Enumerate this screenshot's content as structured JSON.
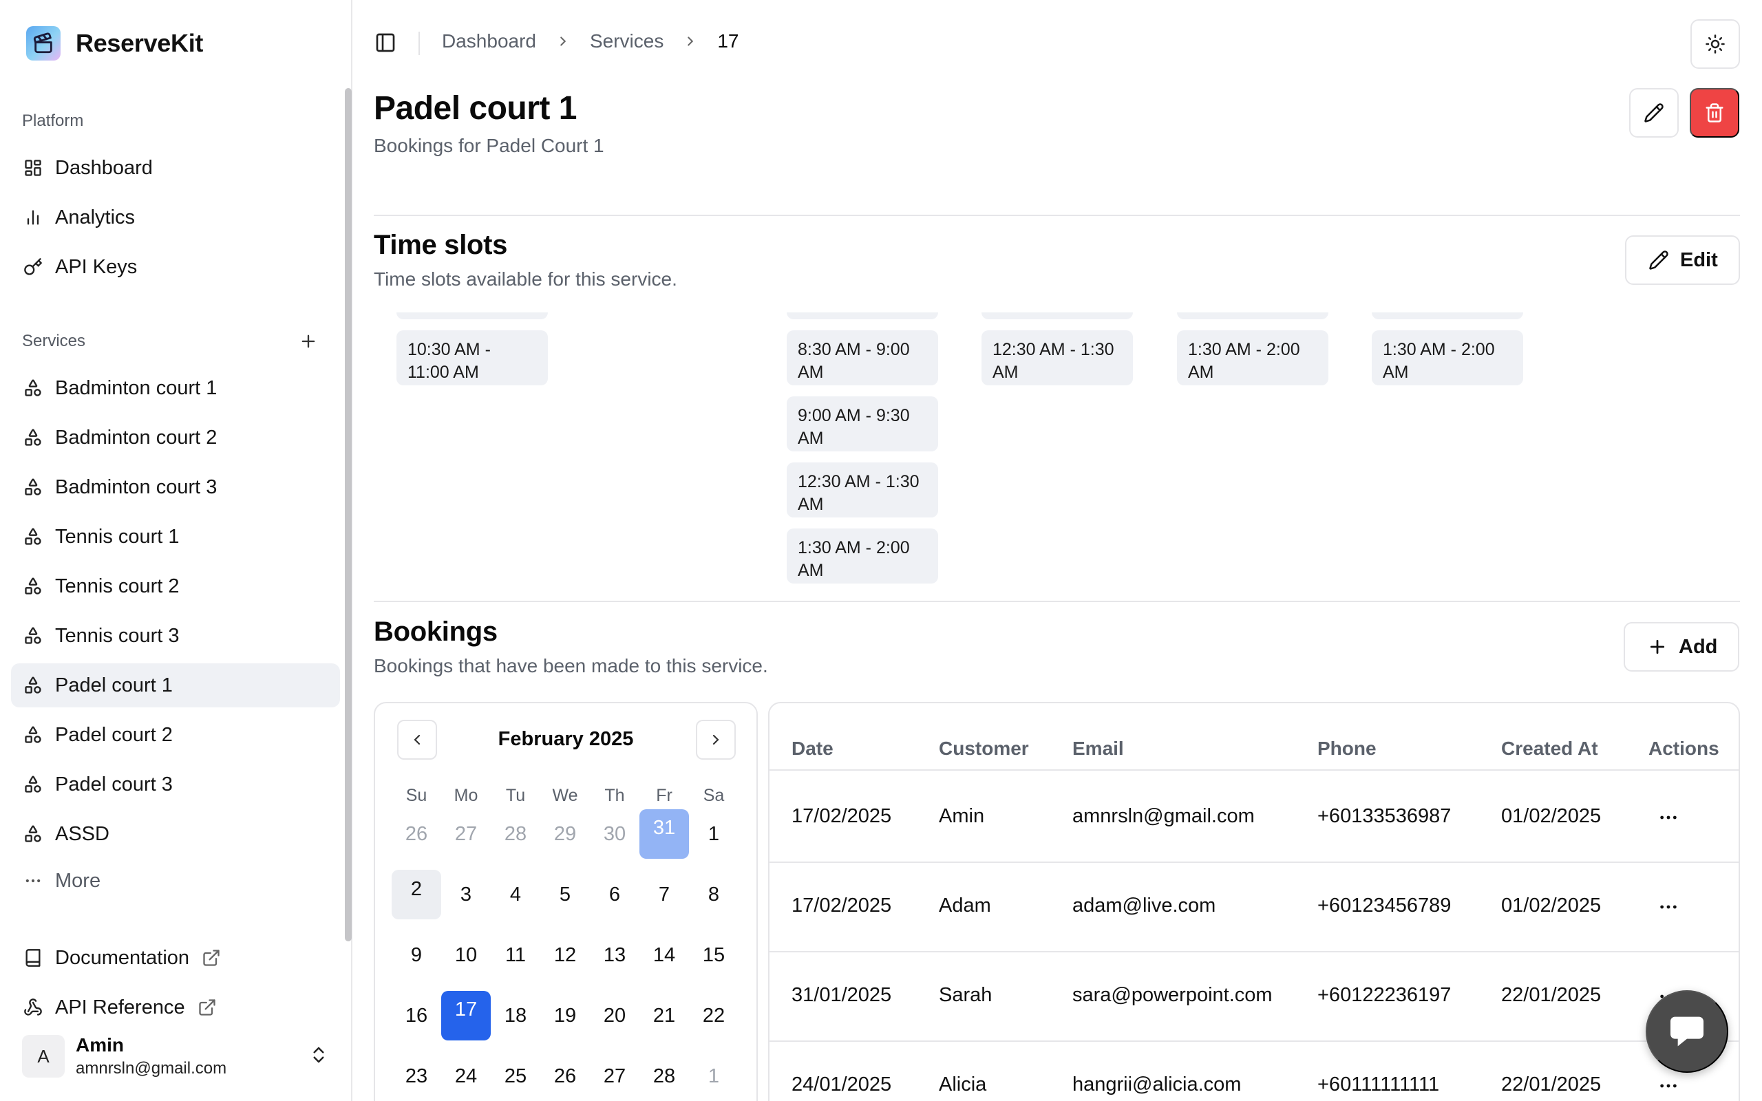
{
  "brand": {
    "name": "ReserveKit"
  },
  "sidebar": {
    "platform_label": "Platform",
    "platform_items": [
      {
        "label": "Dashboard",
        "icon": "dashboard-icon"
      },
      {
        "label": "Analytics",
        "icon": "analytics-icon"
      },
      {
        "label": "API Keys",
        "icon": "key-icon"
      }
    ],
    "services_label": "Services",
    "service_items": [
      {
        "label": "Badminton court 1"
      },
      {
        "label": "Badminton court 2"
      },
      {
        "label": "Badminton court 3"
      },
      {
        "label": "Tennis court 1"
      },
      {
        "label": "Tennis court 2"
      },
      {
        "label": "Tennis court 3"
      },
      {
        "label": "Padel court 1",
        "active": true
      },
      {
        "label": "Padel court 2"
      },
      {
        "label": "Padel court 3"
      },
      {
        "label": "ASSD"
      }
    ],
    "more_label": "More",
    "docs_label": "Documentation",
    "api_ref_label": "API Reference",
    "user": {
      "initial": "A",
      "name": "Amin",
      "email": "amnrsln@gmail.com"
    }
  },
  "header": {
    "breadcrumbs": [
      "Dashboard",
      "Services",
      "17"
    ]
  },
  "page": {
    "title": "Padel court 1",
    "subtitle": "Bookings for Padel Court 1"
  },
  "time_slots": {
    "title": "Time slots",
    "subtitle": "Time slots available for this service.",
    "edit_label": "Edit",
    "columns": [
      {
        "slots": [
          "10:30 AM - 11:00 AM"
        ]
      },
      {
        "slots": []
      },
      {
        "slots": [
          "8:30 AM - 9:00 AM",
          "9:00 AM - 9:30 AM",
          "12:30 AM - 1:30 AM",
          "1:30 AM - 2:00 AM"
        ]
      },
      {
        "slots": [
          "12:30 AM - 1:30 AM"
        ]
      },
      {
        "slots": [
          "1:30 AM - 2:00 AM"
        ]
      },
      {
        "slots": [
          "1:30 AM - 2:00 AM"
        ]
      }
    ]
  },
  "bookings": {
    "title": "Bookings",
    "subtitle": "Bookings that have been made to this service.",
    "add_label": "Add",
    "calendar": {
      "month": "February 2025",
      "weekdays": [
        "Su",
        "Mo",
        "Tu",
        "We",
        "Th",
        "Fr",
        "Sa"
      ],
      "weeks": [
        [
          "26",
          "27",
          "28",
          "29",
          "30",
          "31",
          "1"
        ],
        [
          "2",
          "3",
          "4",
          "5",
          "6",
          "7",
          "8"
        ],
        [
          "9",
          "10",
          "11",
          "12",
          "13",
          "14",
          "15"
        ],
        [
          "16",
          "17",
          "18",
          "19",
          "20",
          "21",
          "22"
        ],
        [
          "23",
          "24",
          "25",
          "26",
          "27",
          "28",
          "1"
        ]
      ]
    },
    "table": {
      "headers": [
        "Date",
        "Customer",
        "Email",
        "Phone",
        "Created At",
        "Actions"
      ],
      "rows": [
        [
          "17/02/2025",
          "Amin",
          "amnrsln@gmail.com",
          "+60133536987",
          "01/02/2025"
        ],
        [
          "17/02/2025",
          "Adam",
          "adam@live.com",
          "+60123456789",
          "01/02/2025"
        ],
        [
          "31/01/2025",
          "Sarah",
          "sara@powerpoint.com",
          "+60122236197",
          "22/01/2025"
        ],
        [
          "24/01/2025",
          "Alicia",
          "hangrii@alicia.com",
          "+60111111111",
          "22/01/2025"
        ]
      ]
    }
  },
  "colors": {
    "accent": "#2563eb",
    "danger": "#ef4444",
    "muted_text": "#5b616b",
    "chip_bg": "#eff1f5"
  }
}
